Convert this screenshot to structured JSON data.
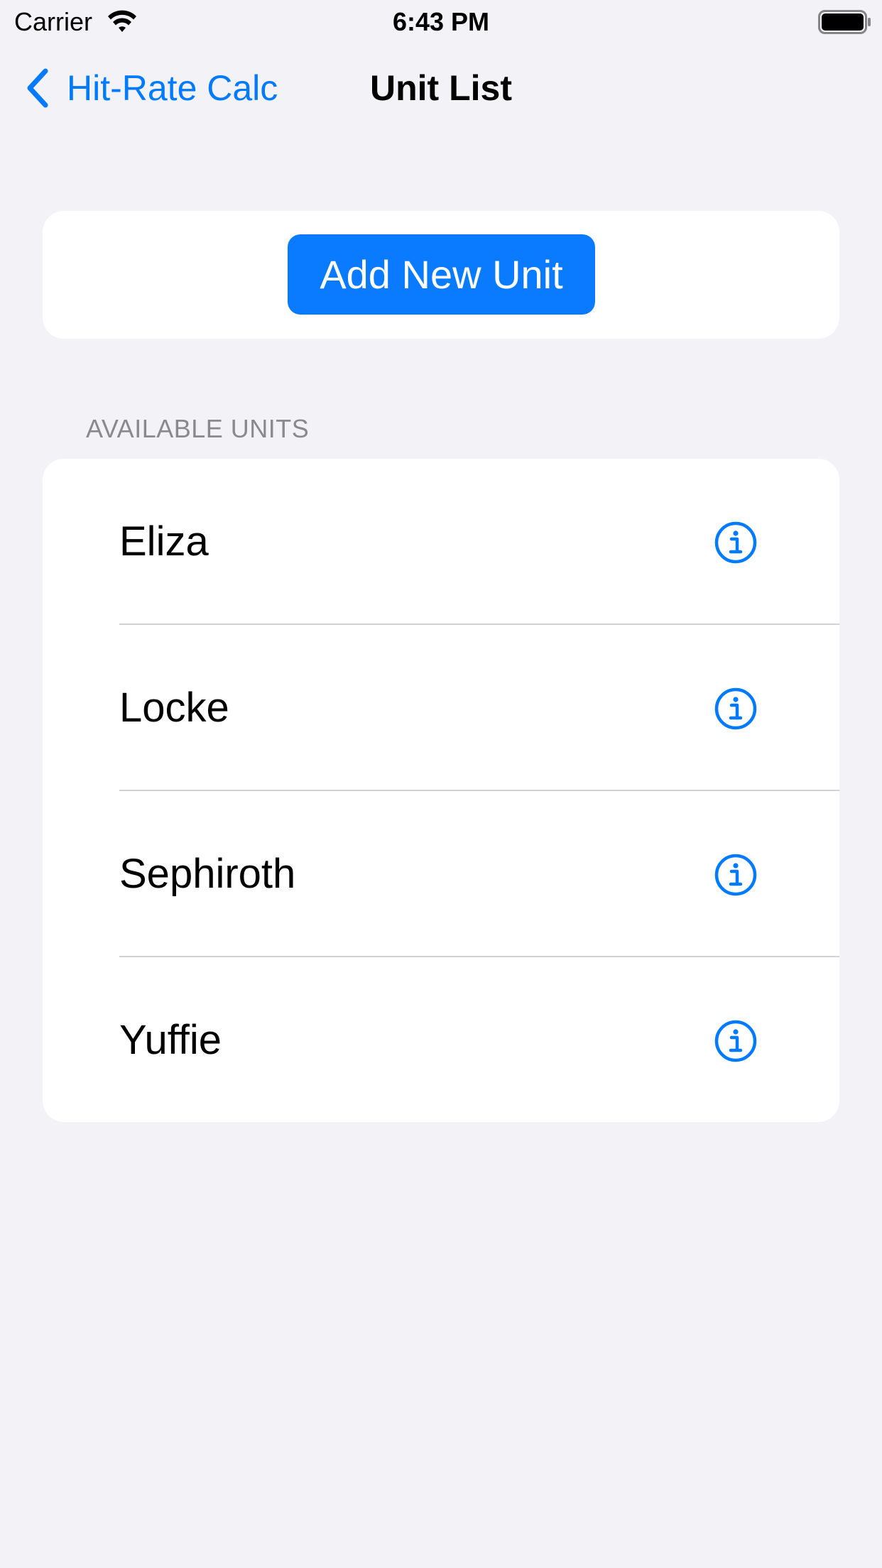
{
  "status_bar": {
    "carrier": "Carrier",
    "time": "6:43 PM",
    "wifi_icon": "wifi-icon",
    "battery_icon": "battery-full-icon"
  },
  "nav": {
    "back_label": "Hit-Rate Calc",
    "back_icon": "chevron-left-icon",
    "title": "Unit List"
  },
  "add_button": {
    "label": "Add New Unit"
  },
  "units_section": {
    "header": "AVAILABLE UNITS",
    "units": [
      {
        "name": "Eliza",
        "icon": "info-circle-icon"
      },
      {
        "name": "Locke",
        "icon": "info-circle-icon"
      },
      {
        "name": "Sephiroth",
        "icon": "info-circle-icon"
      },
      {
        "name": "Yuffie",
        "icon": "info-circle-icon"
      }
    ]
  },
  "colors": {
    "accent": "#007AFF",
    "background": "#F2F2F7",
    "card": "#FFFFFF",
    "section_header": "#8A8A8E",
    "separator": "#D1D1D6"
  }
}
